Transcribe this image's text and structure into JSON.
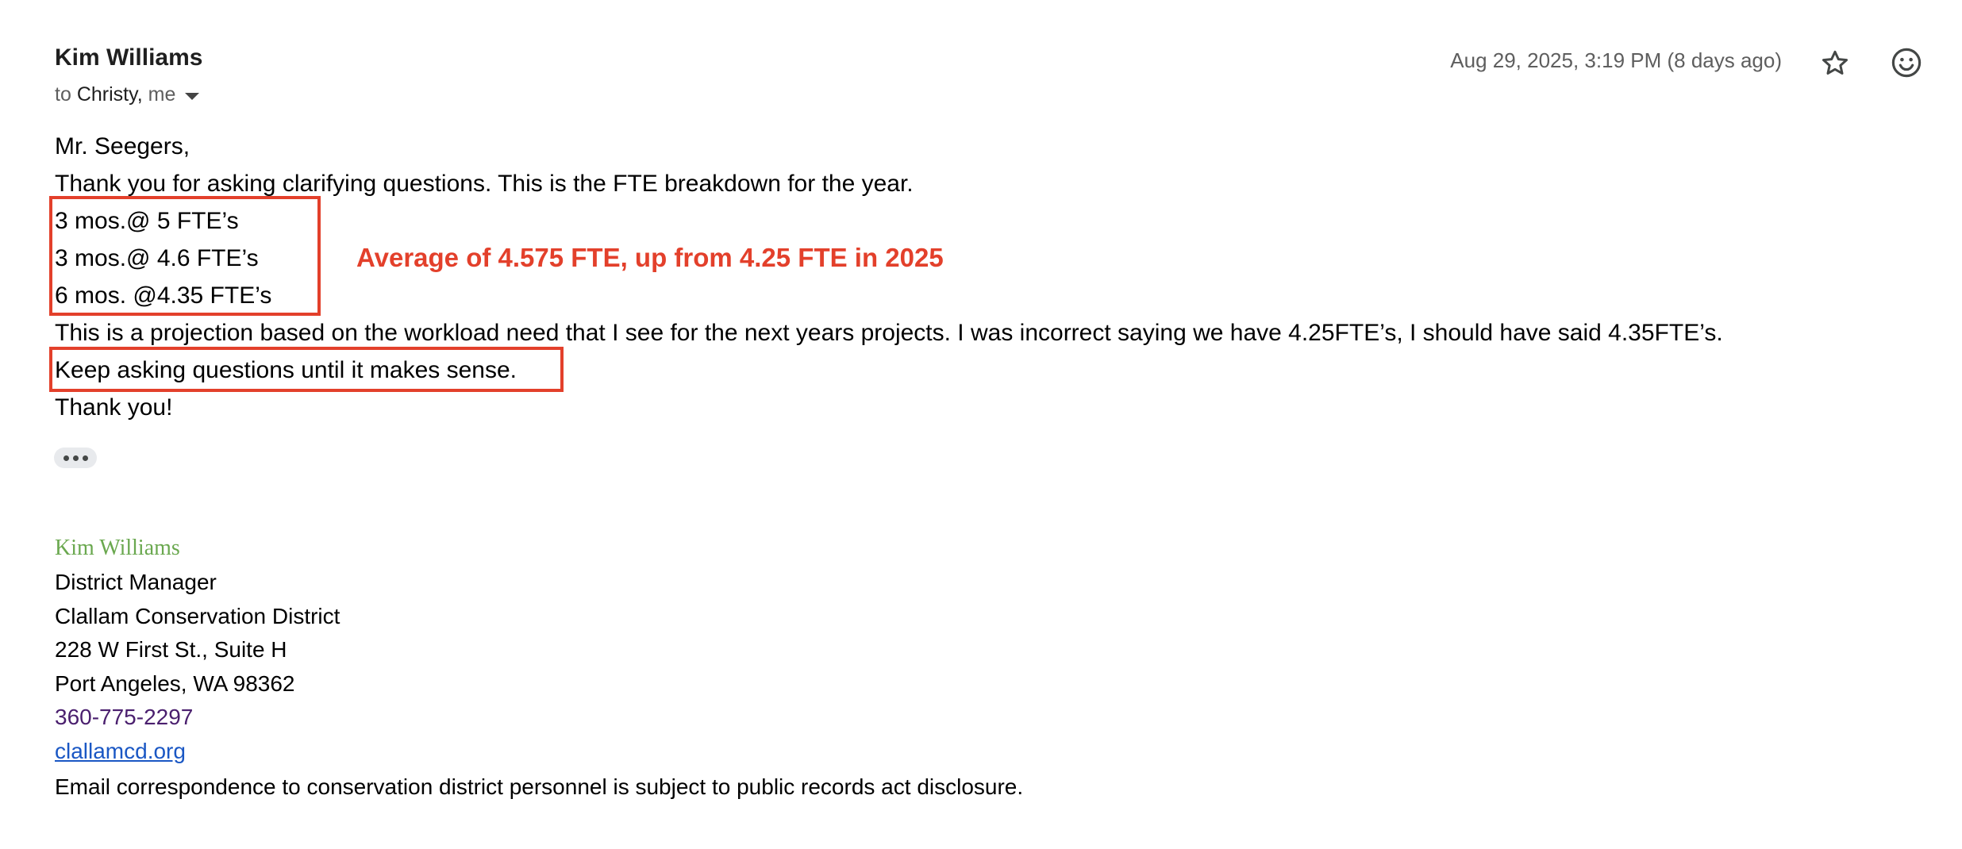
{
  "header": {
    "sender": "Kim Williams",
    "recipients_prefix": "to",
    "recipient_primary": "Christy,",
    "recipient_secondary": "me",
    "timestamp": "Aug 29, 2025, 3:19 PM (8 days ago)",
    "icons": [
      "chevron-down-icon",
      "star-icon",
      "emoji-react-icon"
    ]
  },
  "body": {
    "greeting": "Mr. Seegers,",
    "intro": "Thank you for asking clarifying questions. This is the FTE breakdown for the year.",
    "breakdown": [
      "3 mos.@ 5 FTE’s",
      "3 mos.@ 4.6 FTE’s",
      "6 mos. @4.35 FTE’s"
    ],
    "projection": "This is a projection based on the workload need that I see for the next years projects. I was incorrect saying we have 4.25FTE’s, I should have said 4.35FTE’s.",
    "encouragement": "Keep asking questions until it makes sense.",
    "closing": "Thank you!"
  },
  "annotation": {
    "text": "Average of 4.575 FTE, up from 4.25 FTE in 2025",
    "color": "#e3402b"
  },
  "signature": {
    "name": "Kim Williams",
    "title": "District Manager",
    "organization": "Clallam Conservation District",
    "address_line1": "228 W First St., Suite H",
    "address_line2": "Port Angeles, WA 98362",
    "phone": "360-775-2297",
    "website": "clallamcd.org",
    "disclaimer": "Email correspondence to conservation district personnel is subject to public records act disclosure."
  },
  "colors": {
    "accent_red": "#e3402b",
    "signature_green": "#6aa84f",
    "phone_purple": "#4a1f6e",
    "link_blue": "#1a57c4"
  }
}
